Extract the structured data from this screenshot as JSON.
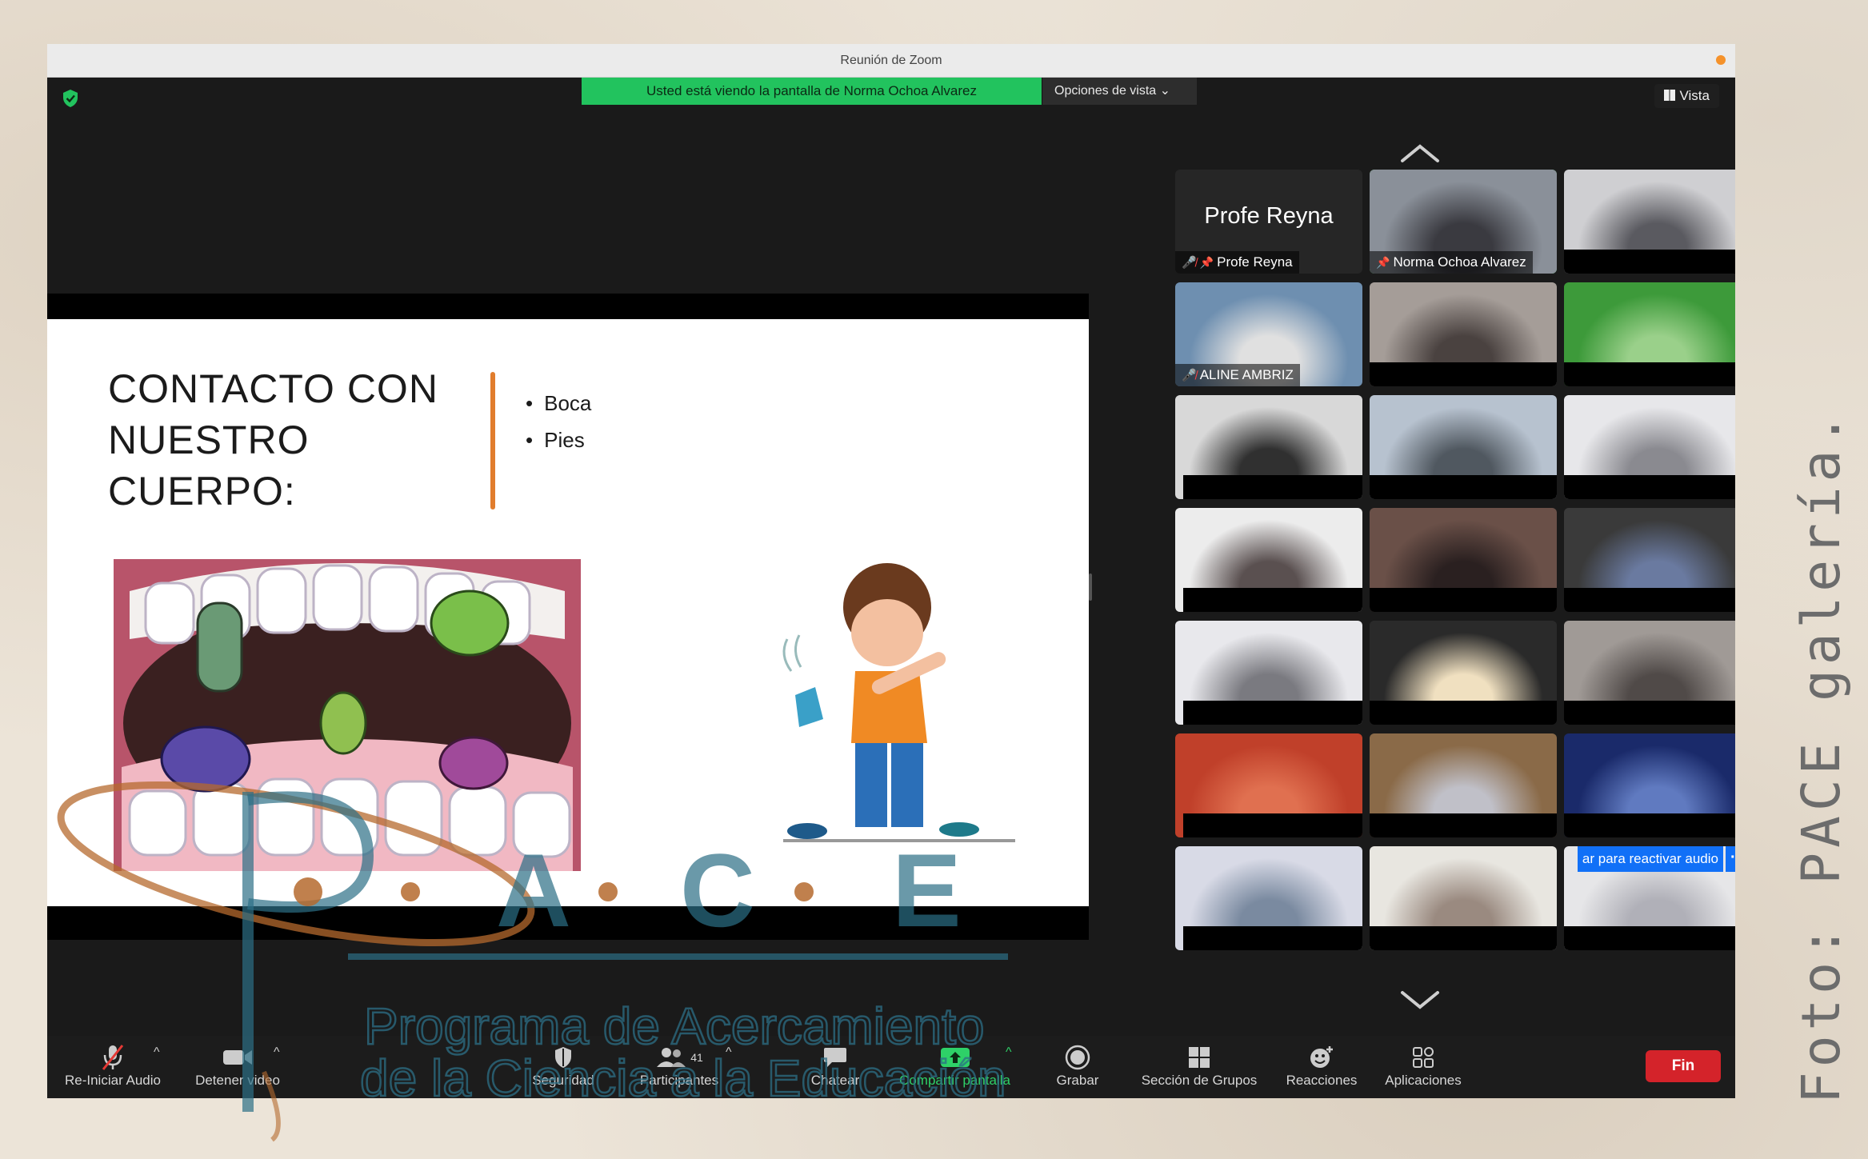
{
  "window": {
    "title": "Reunión de Zoom"
  },
  "banner": {
    "viewing": "Usted está viendo la pantalla de Norma Ochoa Alvarez",
    "view_options": "Opciones de vista"
  },
  "vista": "Vista",
  "slide": {
    "title": "CONTACTO CON NUESTRO CUERPO:",
    "bullets": [
      "Boca",
      "Pies"
    ]
  },
  "gallery": {
    "tiles": [
      {
        "name": "Profe Reyna",
        "muted": true,
        "pinned": true,
        "camera_off": true
      },
      {
        "name": "Norma Ochoa Alvarez",
        "pinned": true,
        "active": true
      },
      {
        "name": ""
      },
      {
        "name": "ALINE AMBRIZ",
        "muted": true
      },
      {
        "name": ""
      },
      {
        "name": ""
      },
      {
        "name": ""
      },
      {
        "name": ""
      },
      {
        "name": ""
      },
      {
        "name": ""
      },
      {
        "name": ""
      },
      {
        "name": ""
      },
      {
        "name": ""
      },
      {
        "name": ""
      },
      {
        "name": ""
      },
      {
        "name": ""
      },
      {
        "name": ""
      },
      {
        "name": ""
      },
      {
        "name": ""
      },
      {
        "name": ""
      },
      {
        "name": ""
      }
    ],
    "unmute_prompt": "ar para reactivar audio"
  },
  "toolbar": {
    "reiniciar_audio": "Re-Iniciar Audio",
    "detener_video": "Detener video",
    "seguridad": "Seguridad",
    "participantes": "Participantes",
    "participant_count": "41",
    "chatear": "Chatear",
    "compartir": "Compartir pantalla",
    "grabar": "Grabar",
    "grupos": "Sección de Grupos",
    "reacciones": "Reacciones",
    "aplicaciones": "Aplicaciones",
    "fin": "Fin"
  },
  "watermark": {
    "letters": [
      "p",
      "A",
      "C",
      "E"
    ],
    "line1": "Programa de Acercamiento",
    "line2": "de la Ciencia a la Educación"
  },
  "credit": "Foto: PACE galería.",
  "colors": {
    "share_green": "#22c35e",
    "active_border": "#33cc55",
    "end_red": "#d4232a",
    "pace_blue": "#2c6f86",
    "pace_orange": "#b56a2e"
  }
}
